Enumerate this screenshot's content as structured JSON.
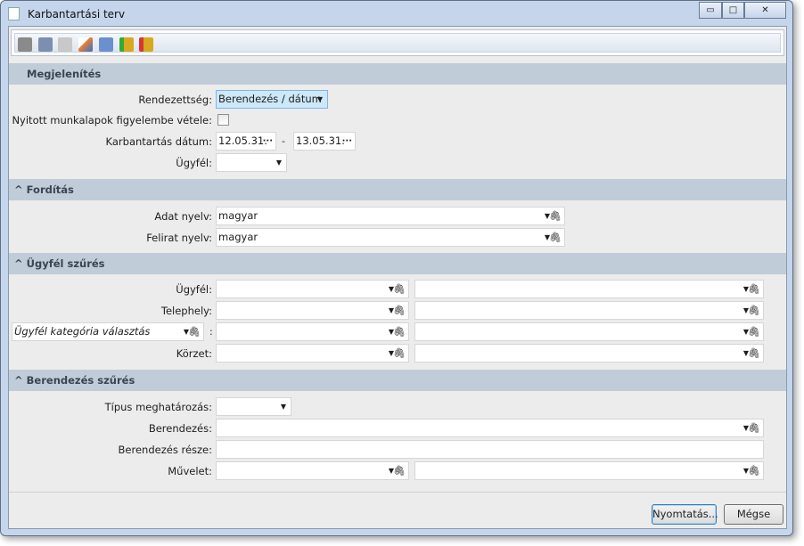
{
  "window": {
    "title": "Karbantartási terv",
    "minimize": "▭",
    "maximize": "□",
    "close": "✕"
  },
  "toolbar": [
    "print-icon",
    "preview-icon",
    "copy-icon",
    "edit-icon",
    "calculator-icon",
    "db-import-icon",
    "db-export-icon"
  ],
  "sections": {
    "display": {
      "title": "Megjelenítés",
      "order_label": "Rendezettség:",
      "order_value": "Berendezés / dátum",
      "open_label": "Nyitott munkalapok figyelembe vétele:",
      "date_label": "Karbantartás dátum:",
      "date_from": "12.05.31.",
      "date_to": "13.05.31.",
      "dash": "-",
      "customer_label": "Ügyfél:",
      "dots": "···"
    },
    "translation": {
      "title": "Fordítás",
      "data_lang_label": "Adat nyelv:",
      "data_lang": "magyar",
      "caption_lang_label": "Felirat nyelv:",
      "caption_lang": "magyar"
    },
    "customer_filter": {
      "title": "Ügyfél szűrés",
      "customer_label": "Ügyfél:",
      "site_label": "Telephely:",
      "category_select": "Ügyfél kategória választás",
      "colon": ":",
      "district_label": "Körzet:"
    },
    "equipment_filter": {
      "title": "Berendezés szűrés",
      "type_label": "Típus meghatározás:",
      "equipment_label": "Berendezés:",
      "part_label": "Berendezés része:",
      "operation_label": "Művelet:"
    }
  },
  "glyphs": {
    "collapse": "^",
    "arrow": "▼",
    "clip": "🖇"
  },
  "buttons": {
    "print": "Nyomtatás...",
    "cancel": "Mégse"
  }
}
